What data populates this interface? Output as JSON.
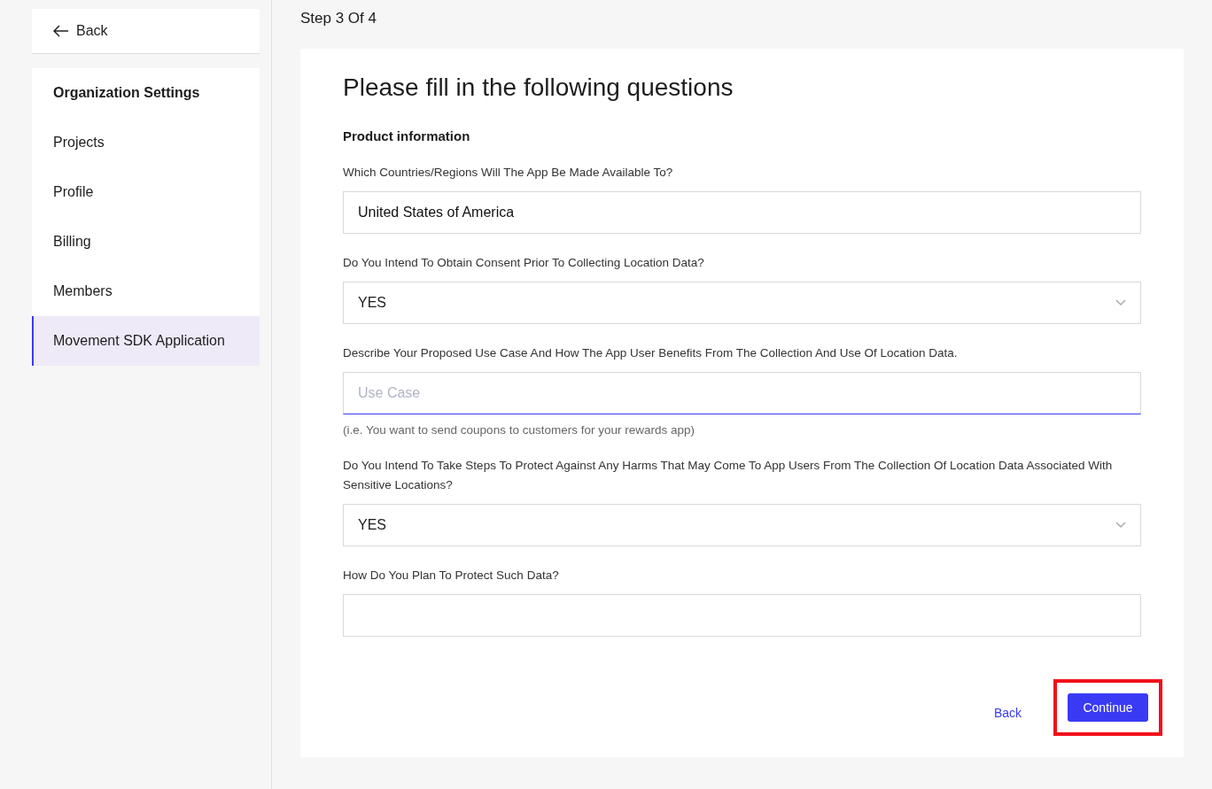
{
  "sidebar": {
    "back": "Back",
    "heading": "Organization Settings",
    "items": [
      {
        "label": "Projects",
        "selected": false
      },
      {
        "label": "Profile",
        "selected": false
      },
      {
        "label": "Billing",
        "selected": false
      },
      {
        "label": "Members",
        "selected": false
      },
      {
        "label": "Movement SDK Application",
        "selected": true
      }
    ]
  },
  "step": "Step 3 Of 4",
  "form": {
    "title": "Please fill in the following questions",
    "section": "Product information",
    "fields": [
      {
        "kind": "text",
        "label": "Which Countries/Regions Will The App Be Made Available To?",
        "value": "United States of America",
        "focused": false
      },
      {
        "kind": "select",
        "label": "Do You Intend To Obtain Consent Prior To Collecting Location Data?",
        "value": "YES",
        "focused": false
      },
      {
        "kind": "text",
        "label": "Describe Your Proposed Use Case And How The App User Benefits From The Collection And Use Of Location Data.",
        "placeholder": "Use Case",
        "hint": "(i.e. You want to send coupons to customers for your rewards app)",
        "focused": true
      },
      {
        "kind": "select",
        "label": "Do You Intend To Take Steps To Protect Against Any Harms That May Come To App Users From The Collection Of Location Data Associated With Sensitive Locations?",
        "value": "YES",
        "focused": false
      },
      {
        "kind": "text",
        "label": "How Do You Plan To Protect Such Data?",
        "focused": false
      }
    ],
    "back": "Back",
    "continue": "Continue",
    "continue_highlighted": true
  }
}
